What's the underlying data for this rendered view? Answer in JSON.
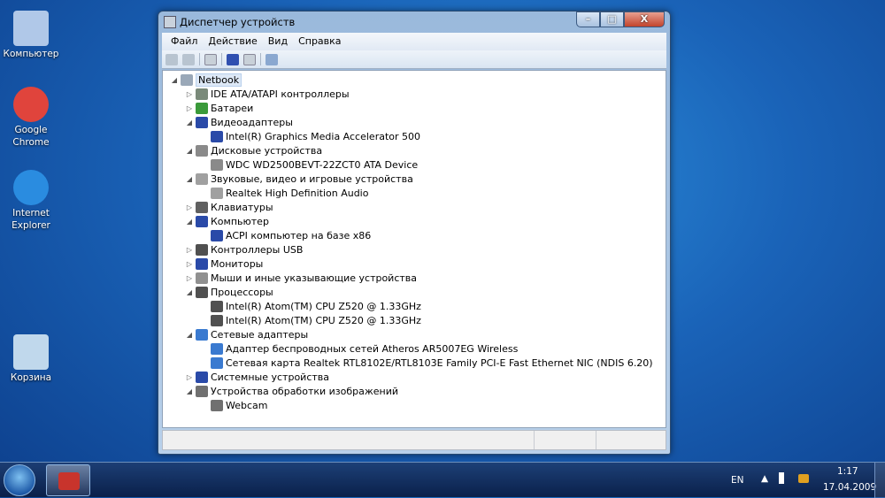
{
  "desktop": {
    "icons": [
      {
        "label": "Компьютер",
        "icon": "computer-icon",
        "color": "#b0c8e8"
      },
      {
        "label": "Google Chrome",
        "icon": "chrome-icon",
        "color": "#e0443c"
      },
      {
        "label": "Internet Explorer",
        "icon": "ie-icon",
        "color": "#2a8ce0"
      },
      {
        "label": "Корзина",
        "icon": "recycle-bin-icon",
        "color": "#c0d8ec"
      }
    ]
  },
  "window": {
    "title": "Диспетчер устройств",
    "minimize": "–",
    "maximize": "□",
    "close": "X"
  },
  "menu": [
    "Файл",
    "Действие",
    "Вид",
    "Справка"
  ],
  "tree": [
    {
      "level": 0,
      "label": "Netbook",
      "exp": "open",
      "color": "#9aa8b8",
      "selected": true
    },
    {
      "level": 1,
      "label": "IDE ATA/ATAPI контроллеры",
      "exp": "closed",
      "color": "#7a8a7a"
    },
    {
      "level": 1,
      "label": "Батареи",
      "exp": "closed",
      "color": "#3a9a3a"
    },
    {
      "level": 1,
      "label": "Видеоадаптеры",
      "exp": "open",
      "color": "#2a4aa8"
    },
    {
      "level": 2,
      "label": "Intel(R) Graphics Media Accelerator 500",
      "exp": "",
      "color": "#2a4aa8"
    },
    {
      "level": 1,
      "label": "Дисковые устройства",
      "exp": "open",
      "color": "#8a8a8a"
    },
    {
      "level": 2,
      "label": "WDC WD2500BEVT-22ZCT0 ATA Device",
      "exp": "",
      "color": "#8a8a8a"
    },
    {
      "level": 1,
      "label": "Звуковые, видео и игровые устройства",
      "exp": "open",
      "color": "#a0a0a0"
    },
    {
      "level": 2,
      "label": "Realtek High Definition Audio",
      "exp": "",
      "color": "#a0a0a0"
    },
    {
      "level": 1,
      "label": "Клавиатуры",
      "exp": "closed",
      "color": "#606060"
    },
    {
      "level": 1,
      "label": "Компьютер",
      "exp": "open",
      "color": "#2a4aa8"
    },
    {
      "level": 2,
      "label": "ACPI компьютер на базе x86",
      "exp": "",
      "color": "#2a4aa8"
    },
    {
      "level": 1,
      "label": "Контроллеры USB",
      "exp": "closed",
      "color": "#505050"
    },
    {
      "level": 1,
      "label": "Мониторы",
      "exp": "closed",
      "color": "#2a4aa8"
    },
    {
      "level": 1,
      "label": "Мыши и иные указывающие устройства",
      "exp": "closed",
      "color": "#909090"
    },
    {
      "level": 1,
      "label": "Процессоры",
      "exp": "open",
      "color": "#505050"
    },
    {
      "level": 2,
      "label": "Intel(R) Atom(TM) CPU Z520   @ 1.33GHz",
      "exp": "",
      "color": "#505050"
    },
    {
      "level": 2,
      "label": "Intel(R) Atom(TM) CPU Z520   @ 1.33GHz",
      "exp": "",
      "color": "#505050"
    },
    {
      "level": 1,
      "label": "Сетевые адаптеры",
      "exp": "open",
      "color": "#3a7ad0"
    },
    {
      "level": 2,
      "label": "Адаптер беспроводных сетей Atheros AR5007EG Wireless",
      "exp": "",
      "color": "#3a7ad0"
    },
    {
      "level": 2,
      "label": "Сетевая карта Realtek RTL8102E/RTL8103E Family PCI-E Fast Ethernet NIC (NDIS 6.20)",
      "exp": "",
      "color": "#3a7ad0"
    },
    {
      "level": 1,
      "label": "Системные устройства",
      "exp": "closed",
      "color": "#2a4aa8"
    },
    {
      "level": 1,
      "label": "Устройства обработки изображений",
      "exp": "open",
      "color": "#707070"
    },
    {
      "level": 2,
      "label": "Webcam",
      "exp": "",
      "color": "#707070"
    }
  ],
  "tray": {
    "lang": "EN",
    "time": "1:17",
    "date": "17.04.2009"
  }
}
